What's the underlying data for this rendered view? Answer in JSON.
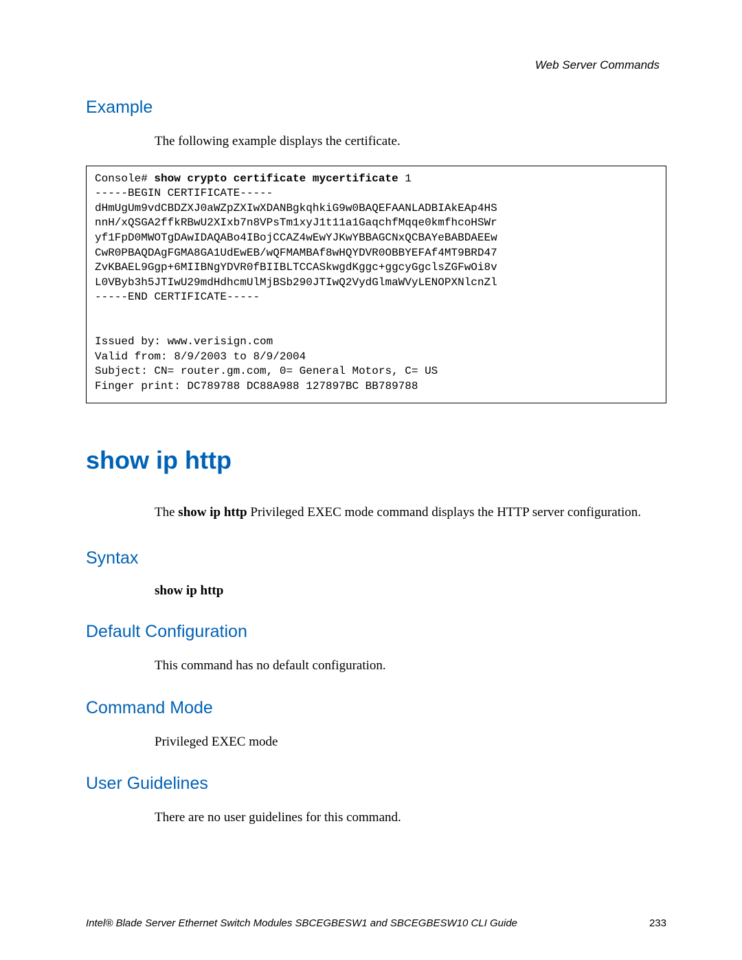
{
  "header": {
    "chapter": "Web Server Commands"
  },
  "example": {
    "heading": "Example",
    "intro": "The following example displays the certificate.",
    "code": {
      "prompt": "Console# ",
      "command": "show crypto certificate mycertificate",
      "arg": " 1",
      "lines": [
        "-----BEGIN CERTIFICATE-----",
        "dHmUgUm9vdCBDZXJ0aWZpZXIwXDANBgkqhkiG9w0BAQEFAANLADBIAkEAp4HS",
        "nnH/xQSGA2ffkRBwU2XIxb7n8VPsTm1xyJ1t11a1GaqchfMqqe0kmfhcoHSWr",
        "yf1FpD0MWOTgDAwIDAQABo4IBojCCAZ4wEwYJKwYBBAGCNxQCBAYeBABDAEEw",
        "CwR0PBAQDAgFGMA8GA1UdEwEB/wQFMAMBAf8wHQYDVR0OBBYEFAf4MT9BRD47",
        "ZvKBAEL9Ggp+6MIIBNgYDVR0fBIIBLTCCASkwgdKggc+ggcyGgclsZGFwOi8v",
        "L0VByb3h5JTIwU29mdHdhcmUlMjBSb290JTIwQ2VydGlmaWVyLENOPXNlcnZl",
        "-----END CERTIFICATE-----",
        "",
        "",
        "Issued by: www.verisign.com",
        "Valid from: 8/9/2003 to 8/9/2004",
        "Subject: CN= router.gm.com, 0= General Motors, C= US",
        "Finger print: DC789788 DC88A988 127897BC BB789788"
      ]
    }
  },
  "command": {
    "title": "show ip http",
    "description_prefix": "The ",
    "description_cmd": "show ip http",
    "description_suffix": " Privileged EXEC mode command displays the HTTP server configuration."
  },
  "syntax": {
    "heading": "Syntax",
    "text": "show ip http"
  },
  "default_config": {
    "heading": "Default Configuration",
    "text": "This command has no default configuration."
  },
  "command_mode": {
    "heading": "Command Mode",
    "text": "Privileged EXEC mode"
  },
  "user_guidelines": {
    "heading": "User Guidelines",
    "text": "There are no user guidelines for this command."
  },
  "footer": {
    "book": "Intel® Blade Server Ethernet Switch Modules SBCEGBESW1 and SBCEGBESW10 CLI Guide",
    "page": "233"
  }
}
